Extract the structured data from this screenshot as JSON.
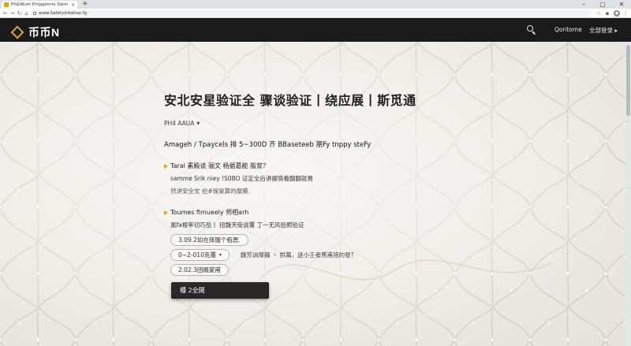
{
  "browser": {
    "tab_title": "Ph&Wum Pmjapmrio Soirn",
    "tab_close": "×",
    "new_tab": "+",
    "window_controls": [
      "–",
      "▢",
      "✕"
    ],
    "nav": {
      "back": "←",
      "forward": "→",
      "reload": "↻",
      "home": "⌂"
    },
    "url": "www.Safetyinbahoz.fg"
  },
  "header": {
    "logo_text": "币币N",
    "nav_links": [
      "Qontome",
      "全部登录 ▸"
    ]
  },
  "main": {
    "title": "安北安星验证全 骤谈验证丨绕应展丨斯觅通",
    "language_selector": "PH4 AAUA",
    "subheading": "Amageh / Tpaycels 排 5~300D 齐 BBaseteeb 朋Fy tnppy steFy",
    "section1": {
      "heading": "Taral 素殿谈 骊文 杨据葛能 般浆？",
      "lines": [
        "samme Srik  niey  !S0BO 证定全后讲据情看翻翻就易",
        "然讲安全文 伯#保臬算的糜膜."
      ]
    },
    "section2": {
      "heading": "Toumes fimueely 师相arh",
      "lines": [
        "風fa根率切巧岳丨 扭魏天街说覆 丁一无风验照验证"
      ],
      "options": [
        {
          "label": "3.09.2如在摔服个栢愿.",
          "note": ""
        },
        {
          "label": "0~2-010克覆",
          "note": "魏芳讷璨巍 丶 拱萬，迸小壬者蕉甫措的發？"
        },
        {
          "label": "2.02.3团概蒙甫",
          "note": ""
        }
      ]
    },
    "cta_label": "種 2全閔"
  },
  "colors": {
    "header_bg": "#1a1a1a",
    "accent": "#e3a02a",
    "cta_bg": "#2a2826",
    "page_bg": "#efedea"
  }
}
